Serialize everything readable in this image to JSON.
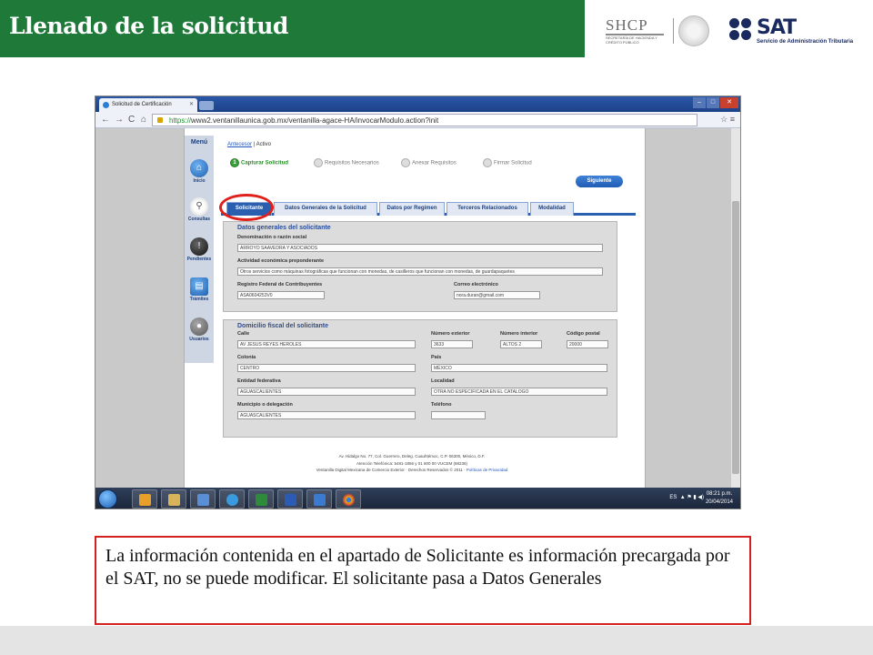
{
  "slide": {
    "title": "Llenado de la solicitud",
    "header_color": "#1f7a3a",
    "caption": "La información contenida en el apartado de Solicitante es información precargada  por el SAT, no se puede modificar. El solicitante pasa a Datos Generales"
  },
  "logos": {
    "shcp": "SHCP",
    "shcp_sub": "SECRETARÍA DE HACIENDA Y CRÉDITO PÚBLICO",
    "sat": "SAT",
    "sat_sub": "Servicio de Administración Tributaria"
  },
  "browser": {
    "tab_title": "Solicitud de Certificación",
    "url_scheme": "https://",
    "url_rest": "www2.ventanillaunica.gob.mx/ventanilla-agace-HA/invocarModulo.action?init"
  },
  "sidebar": {
    "title": "Menú",
    "items": [
      {
        "label": "Inicio",
        "icon": "home-icon"
      },
      {
        "label": "Consultas",
        "icon": "magnifier-icon"
      },
      {
        "label": "Pendientes",
        "icon": "alert-icon"
      },
      {
        "label": "Trámites",
        "icon": "document-icon"
      },
      {
        "label": "Usuarios",
        "icon": "user-icon"
      }
    ]
  },
  "breadcrumb": {
    "prev": "Antecesor",
    "sep": " | ",
    "current": "Activo"
  },
  "steps": [
    {
      "num": "1",
      "label": "Capturar Solicitud"
    },
    {
      "num": "",
      "label": "Requisitos Necesarios"
    },
    {
      "num": "",
      "label": "Anexar Requisitos"
    },
    {
      "num": "",
      "label": "Firmar Solicitud"
    }
  ],
  "next_button": "Siguiente",
  "tabs": [
    "Solicitante",
    "Datos Generales de la Solicitud",
    "Datos por Regimen",
    "Terceros Relacionados",
    "Modalidad"
  ],
  "general": {
    "title": "Datos generales del solicitante",
    "name_label": "Denominación o razón social",
    "name_value": "ARROYO SAAVEDRA Y ASOCIADOS",
    "activity_label": "Actividad económica preponderante",
    "activity_value": "Otros servicios como máquinas fotográficas que funcionan con monedas, de casilleros que funcionan con monedas, de guardapaquetes",
    "rfc_label": "Registro Federal de Contribuyentes",
    "rfc_value": "ASA0604253V0",
    "email_label": "Correo electrónico",
    "email_value": "nora.duran@gmail.com"
  },
  "address": {
    "title": "Domicilio fiscal del solicitante",
    "street_label": "Calle",
    "street_value": "AV JESUS REYES HEROLES",
    "ext_label": "Número exterior",
    "ext_value": "3633",
    "int_label": "Número interior",
    "int_value": "ALTOS 2",
    "zip_label": "Código postal",
    "zip_value": "20000",
    "colonia_label": "Colonia",
    "colonia_value": "CENTRO",
    "country_label": "País",
    "country_value": "MÉXICO",
    "state_label": "Entidad federativa",
    "state_value": "AGUASCALIENTES",
    "locality_label": "Localidad",
    "locality_value": "OTRA NO ESPECIFICADA EN EL CATALOGO",
    "municipality_label": "Municipio o delegación",
    "municipality_value": "AGUASCALIENTES",
    "phone_label": "Teléfono",
    "phone_value": ""
  },
  "footer": {
    "line1": "Av. Hidalgo No. 77, Col. Guerrero, Deleg. Cuauhtémoc, C.P. 06300, México, D.F.",
    "line2": "Atención Telefónica: 5481-1856 y 01 800 00 VUCEM (88236)",
    "line3": "Ventanilla Digital Mexicana de Comercio Exterior · Derechos Reservados © 2011 · ",
    "privacy": "Políticas de Privacidad"
  },
  "taskbar": {
    "lang": "ES",
    "time": "08:21 p.m.",
    "date": "20/04/2014"
  }
}
